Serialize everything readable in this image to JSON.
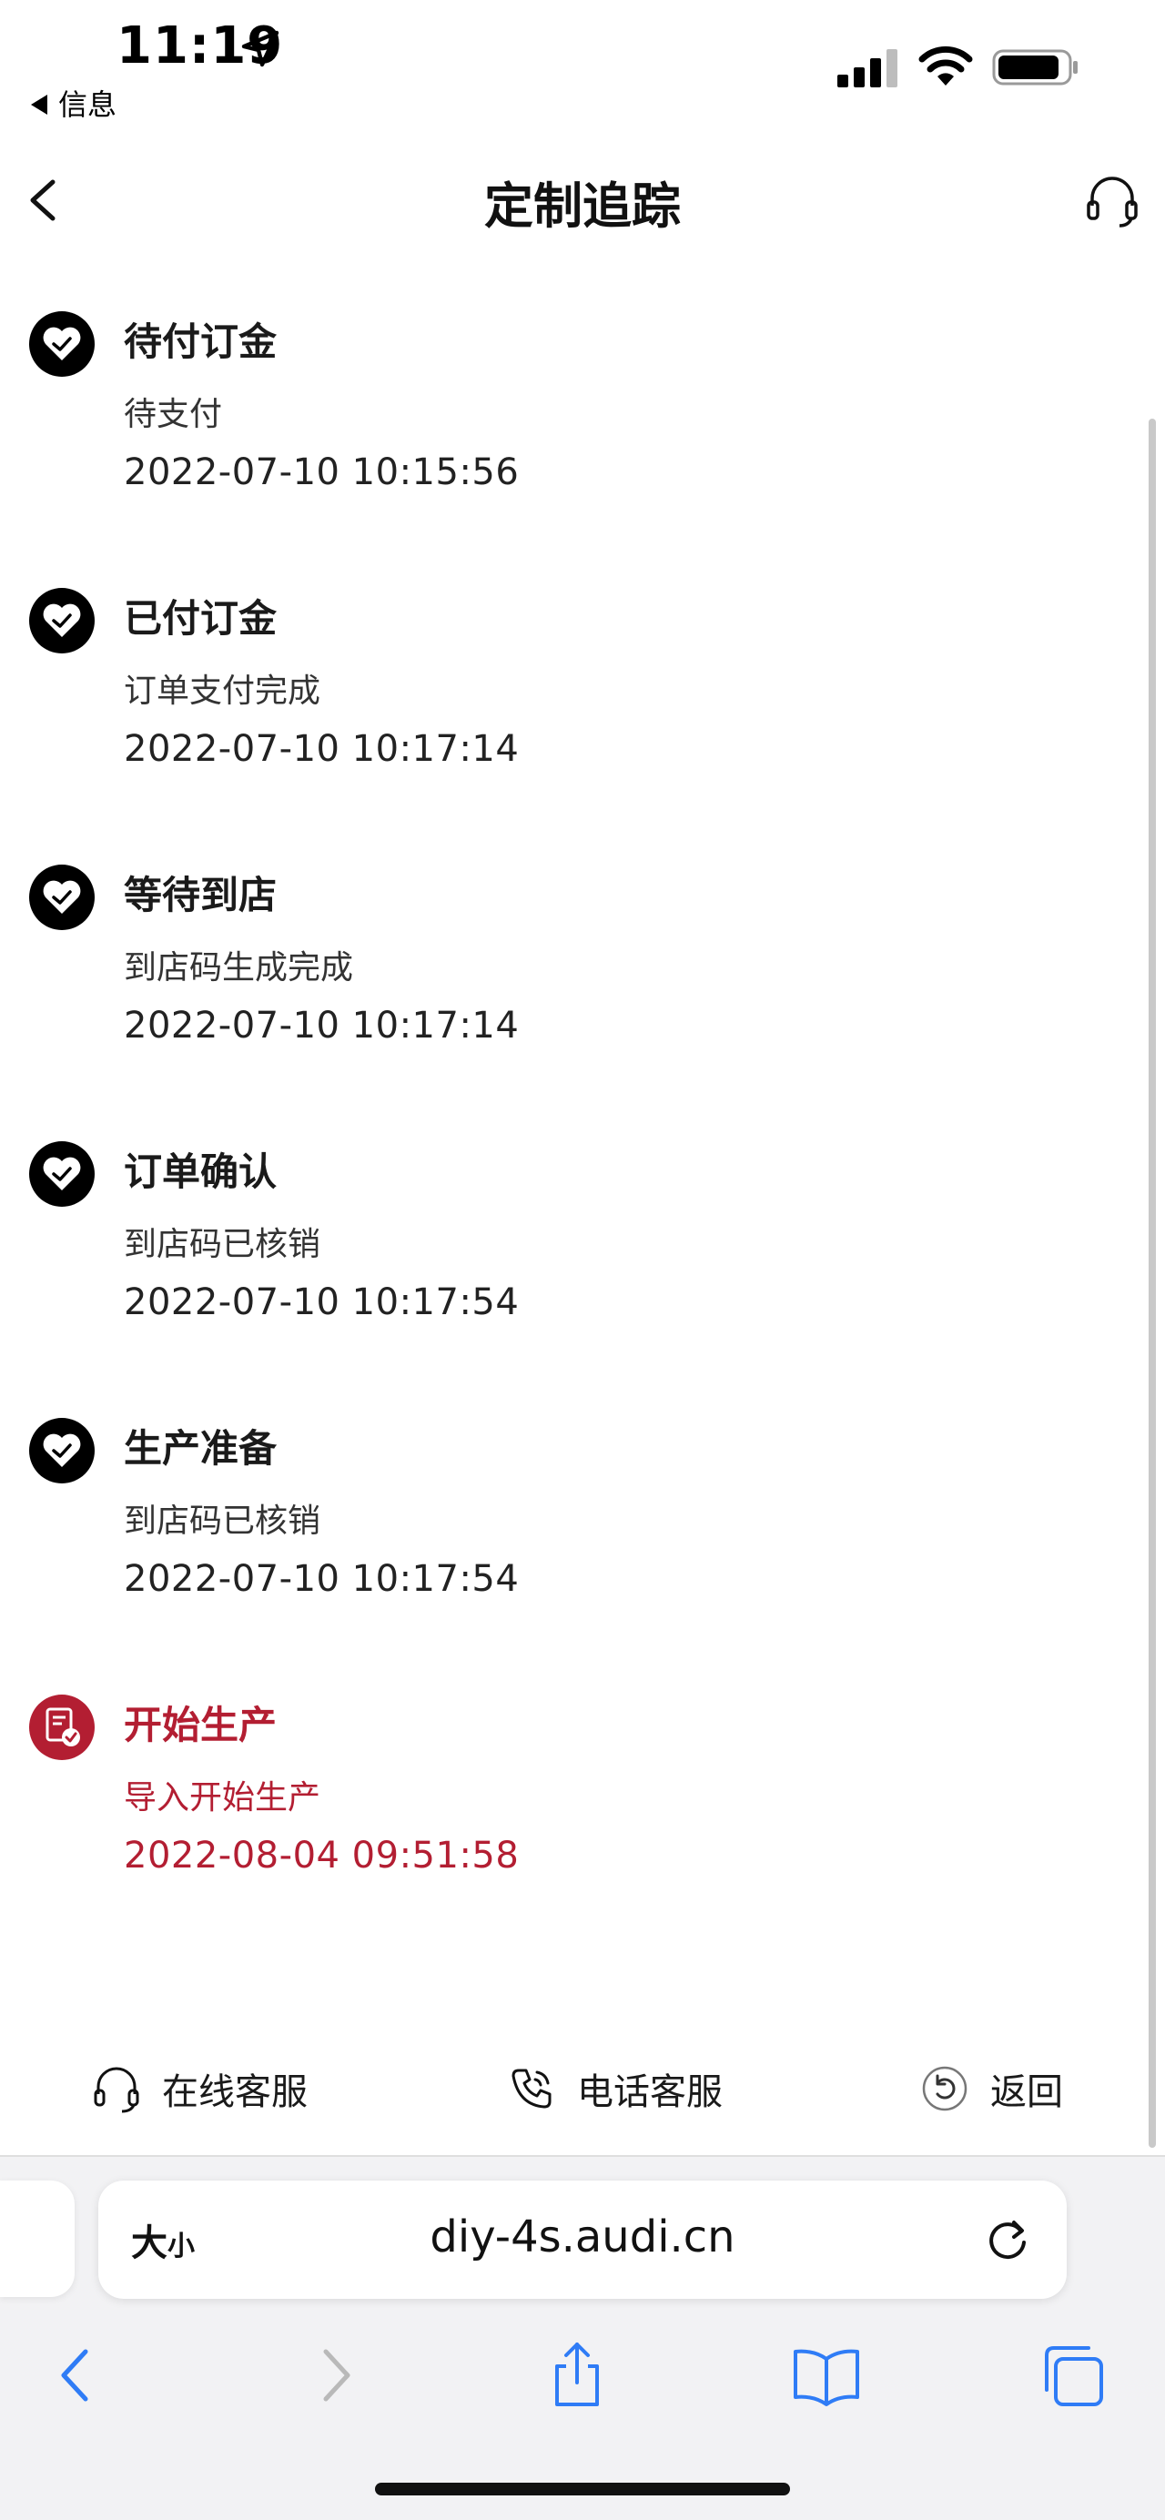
{
  "status_bar": {
    "time": "11:19",
    "back_app": "信息"
  },
  "nav": {
    "title": "定制追踪"
  },
  "steps": [
    {
      "title": "待付订金",
      "desc": "待支付",
      "time": "2022-07-10 10:15:56",
      "active": false
    },
    {
      "title": "已付订金",
      "desc": "订单支付完成",
      "time": "2022-07-10 10:17:14",
      "active": false
    },
    {
      "title": "等待到店",
      "desc": "到店码生成完成",
      "time": "2022-07-10 10:17:14",
      "active": false
    },
    {
      "title": "订单确认",
      "desc": "到店码已核销",
      "time": "2022-07-10 10:17:54",
      "active": false
    },
    {
      "title": "生产准备",
      "desc": "到店码已核销",
      "time": "2022-07-10 10:17:54",
      "active": false
    },
    {
      "title": "开始生产",
      "desc": "导入开始生产",
      "time": "2022-08-04 09:51:58",
      "active": true
    }
  ],
  "actions": {
    "online_service": "在线客服",
    "phone_service": "电话客服",
    "back": "返回"
  },
  "browser": {
    "text_size_label_big": "大",
    "text_size_label_small": "小",
    "url": "diy-4s.audi.cn"
  },
  "colors": {
    "accent": "#b31e32",
    "done_icon": "#000000",
    "ios_blue": "#2f7cf6"
  }
}
